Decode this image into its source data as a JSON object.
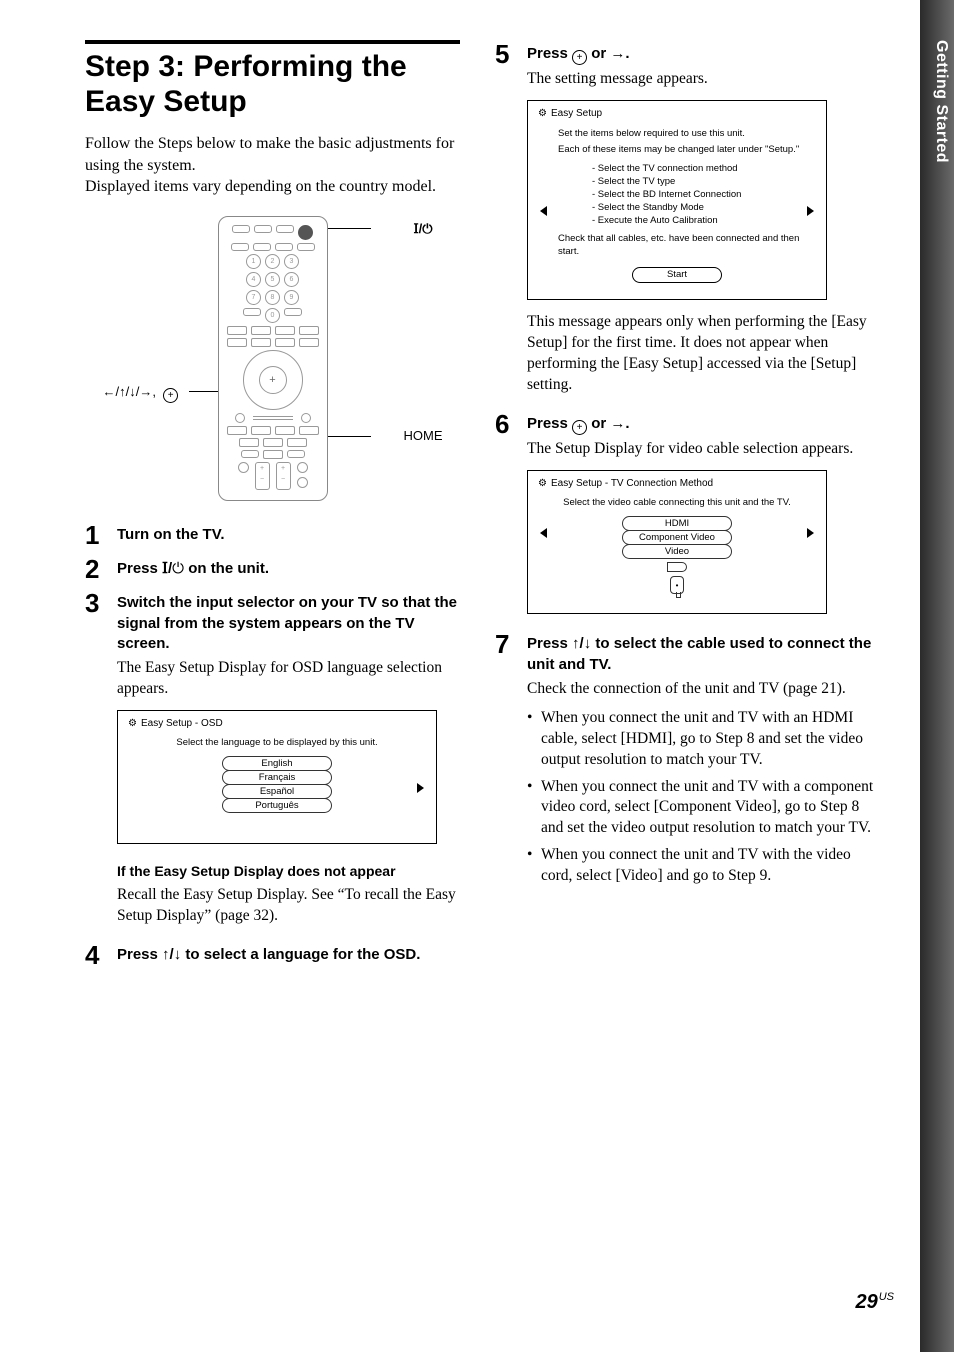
{
  "sideTab": "Getting Started",
  "title": "Step 3: Performing the Easy Setup",
  "intro": "Follow the Steps below to make the basic adjustments for using the system.\nDisplayed items vary depending on the country model.",
  "remoteLabels": {
    "power": "Ⅰ/⏻",
    "nav": "←/↑/↓/→, ⊕",
    "home": "HOME"
  },
  "leftSteps": {
    "s1": {
      "num": "1",
      "title": "Turn on the TV."
    },
    "s2": {
      "num": "2",
      "title_pre": "Press ",
      "title_sym": "Ⅰ/⏻",
      "title_post": " on the unit."
    },
    "s3": {
      "num": "3",
      "title": "Switch the input selector on your TV so that the signal from the system appears on the TV screen.",
      "p": "The Easy Setup Display for OSD language selection appears."
    },
    "osd": {
      "header": "Easy Setup - OSD",
      "instr": "Select the language to be displayed by this unit.",
      "opts": [
        "English",
        "Français",
        "Español",
        "Português"
      ]
    },
    "noAppear": {
      "h": "If the Easy Setup Display does not appear",
      "p": "Recall the Easy Setup Display. See “To recall the Easy Setup Display” (page 32)."
    },
    "s4": {
      "num": "4",
      "title": "Press ↑/↓ to select a language for the OSD."
    }
  },
  "rightSteps": {
    "s5": {
      "num": "5",
      "title_pre": "Press ",
      "title_post": " or →.",
      "p": "The setting message appears."
    },
    "easySetup": {
      "header": "Easy Setup",
      "line1": "Set the items below required to use this unit.",
      "line2": "Each of these items may be changed later under \"Setup.\"",
      "items": [
        "- Select the TV connection method",
        "- Select the TV type",
        "- Select the BD Internet Connection",
        "- Select the Standby Mode",
        "- Execute the Auto Calibration"
      ],
      "check": "Check that all cables, etc. have been connected and then start.",
      "start": "Start"
    },
    "s5note": "This message appears only when performing the [Easy Setup] for the first time. It does not appear when performing the [Easy Setup] accessed via the [Setup] setting.",
    "s6": {
      "num": "6",
      "title_pre": "Press ",
      "title_post": " or →.",
      "p": "The Setup Display for video cable selection appears."
    },
    "tvconn": {
      "header": "Easy Setup - TV Connection Method",
      "instr": "Select the video cable connecting this unit and the TV.",
      "opts": [
        "HDMI",
        "Component Video",
        "Video"
      ]
    },
    "s7": {
      "num": "7",
      "title": "Press ↑/↓ to select the cable used to connect the unit and TV.",
      "p": "Check the connection of the unit and TV (page 21).",
      "b1": "When you connect the unit and TV with an HDMI cable, select [HDMI], go to Step 8 and set the video output resolution to match your TV.",
      "b2": "When you connect the unit and TV with a component video cord, select [Component Video], go to Step 8 and set the video output resolution to match your TV.",
      "b3": "When you connect the unit and TV with the video cord, select [Video] and go to Step 9."
    }
  },
  "pageNum": "29",
  "pageSup": "US"
}
